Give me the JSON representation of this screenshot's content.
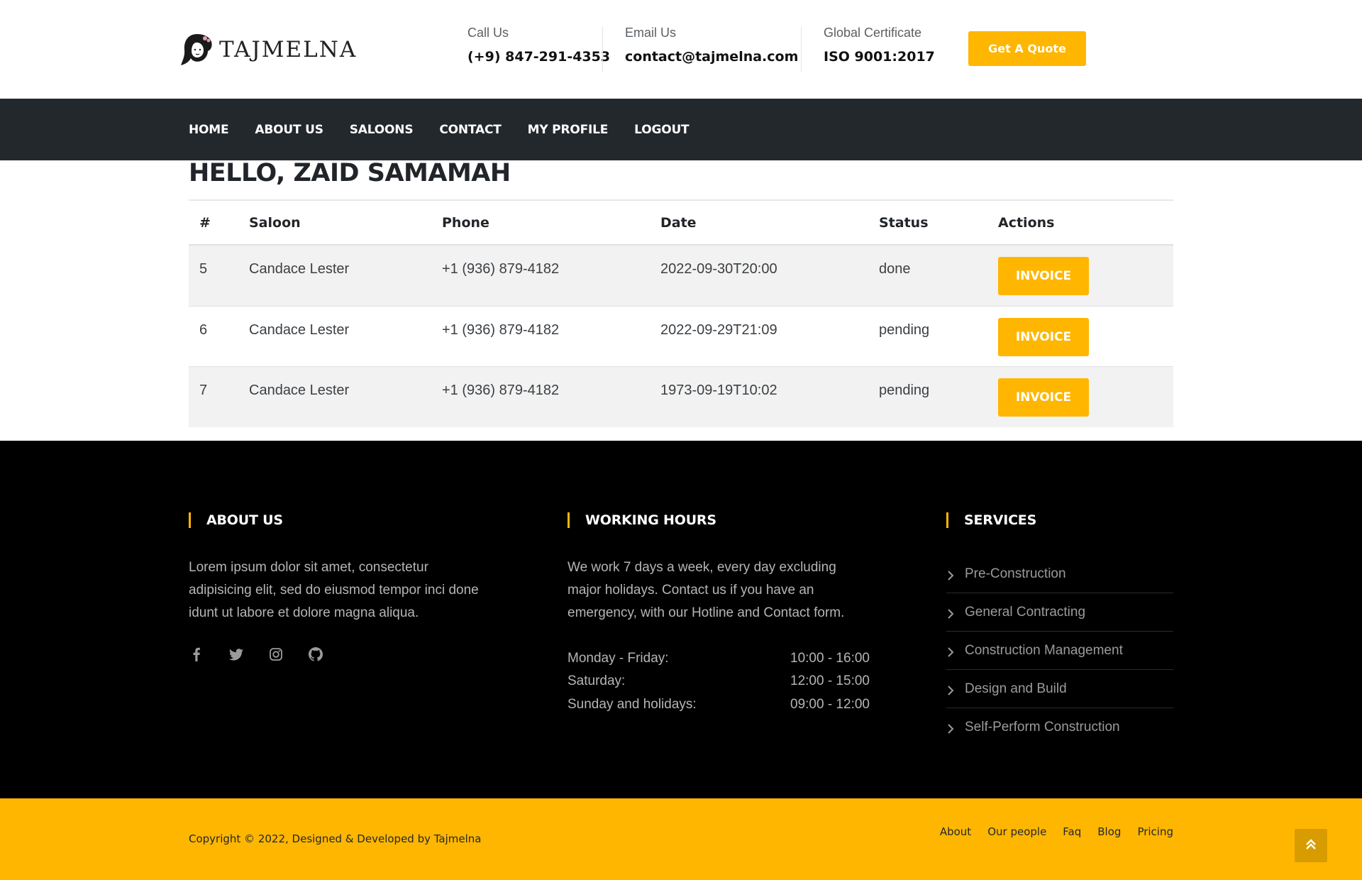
{
  "brand": {
    "name": "TAJMELNA"
  },
  "header": {
    "call": {
      "label": "Call Us",
      "value": "(+9) 847-291-4353"
    },
    "email": {
      "label": "Email Us",
      "value": "contact@tajmelna.com"
    },
    "certificate": {
      "label": "Global Certificate",
      "value": "ISO 9001:2017"
    },
    "quote_button": "Get A Quote",
    "accent_color": "#ffb600"
  },
  "nav": {
    "items": [
      "HOME",
      "ABOUT US",
      "SALOONS",
      "CONTACT",
      "MY PROFILE",
      "LOGOUT"
    ],
    "background": "#23282d"
  },
  "greeting": "HELLO, ZAID SAMAMAH",
  "table": {
    "headers": [
      "#",
      "Saloon",
      "Phone",
      "Date",
      "Status",
      "Actions"
    ],
    "rows": [
      {
        "id": "5",
        "saloon": "Candace Lester",
        "phone": "+1 (936) 879-4182",
        "date": "2022-09-30T20:00",
        "status": "done",
        "action": "INVOICE"
      },
      {
        "id": "6",
        "saloon": "Candace Lester",
        "phone": "+1 (936) 879-4182",
        "date": "2022-09-29T21:09",
        "status": "pending",
        "action": "INVOICE"
      },
      {
        "id": "7",
        "saloon": "Candace Lester",
        "phone": "+1 (936) 879-4182",
        "date": "1973-09-19T10:02",
        "status": "pending",
        "action": "INVOICE"
      }
    ]
  },
  "footer": {
    "about": {
      "title": "ABOUT US",
      "lines": [
        "Lorem ipsum dolor sit amet, consectetur",
        "adipisicing elit, sed do eiusmod tempor inci done",
        "idunt ut labore et dolore magna aliqua."
      ],
      "social": [
        "facebook-icon",
        "twitter-icon",
        "instagram-icon",
        "github-icon"
      ]
    },
    "hours": {
      "title": "WORKING HOURS",
      "lines": [
        "We work 7 days a week, every day excluding",
        "major holidays. Contact us if you have an",
        "emergency, with our Hotline and Contact form."
      ],
      "schedule": [
        {
          "day": "Monday - Friday:",
          "time": "10:00 - 16:00"
        },
        {
          "day": "Saturday:",
          "time": "12:00 - 15:00"
        },
        {
          "day": "Sunday and holidays:",
          "time": "09:00 - 12:00"
        }
      ]
    },
    "services": {
      "title": "SERVICES",
      "items": [
        "Pre-Construction",
        "General Contracting",
        "Construction Management",
        "Design and Build",
        "Self-Perform Construction"
      ]
    }
  },
  "copyright": {
    "text": "Copyright © 2022, Designed & Developed by Tajmelna",
    "links": [
      "About",
      "Our people",
      "Faq",
      "Blog",
      "Pricing"
    ]
  }
}
